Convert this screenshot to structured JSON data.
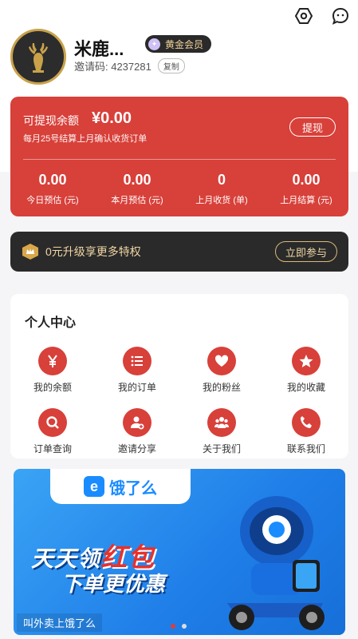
{
  "profile": {
    "name": "米鹿...",
    "member_badge": "黄金会员",
    "invite_label": "邀请码: 4237281",
    "copy_label": "复制"
  },
  "wallet": {
    "withdrawable_label": "可提现余额",
    "amount": "¥0.00",
    "note": "每月25号结算上月确认收货订单",
    "withdraw_button": "提现",
    "stats": [
      {
        "value": "0.00",
        "label": "今日预估 (元)"
      },
      {
        "value": "0.00",
        "label": "本月预估 (元)"
      },
      {
        "value": "0",
        "label": "上月收货 (单)"
      },
      {
        "value": "0.00",
        "label": "上月结算 (元)"
      }
    ]
  },
  "promo": {
    "text": "0元升级享更多特权",
    "button": "立即参与"
  },
  "center": {
    "title": "个人中心",
    "items": [
      {
        "label": "我的余额",
        "icon": "yen-icon"
      },
      {
        "label": "我的订单",
        "icon": "list-icon"
      },
      {
        "label": "我的粉丝",
        "icon": "heart-icon"
      },
      {
        "label": "我的收藏",
        "icon": "star-icon"
      },
      {
        "label": "订单查询",
        "icon": "search-icon"
      },
      {
        "label": "邀请分享",
        "icon": "user-add-icon"
      },
      {
        "label": "关于我们",
        "icon": "group-icon"
      },
      {
        "label": "联系我们",
        "icon": "phone-icon"
      }
    ]
  },
  "banner": {
    "brand_mark": "e",
    "brand": "饿了么",
    "line1a": "天天领",
    "line1b": "红包",
    "line2": "下单更优惠",
    "caption": "叫外卖上饿了么"
  },
  "colors": {
    "primary_red": "#d8403a",
    "dark": "#2a2a2a",
    "gold": "#f0d6a4",
    "banner_blue": "#1f7ee8"
  }
}
